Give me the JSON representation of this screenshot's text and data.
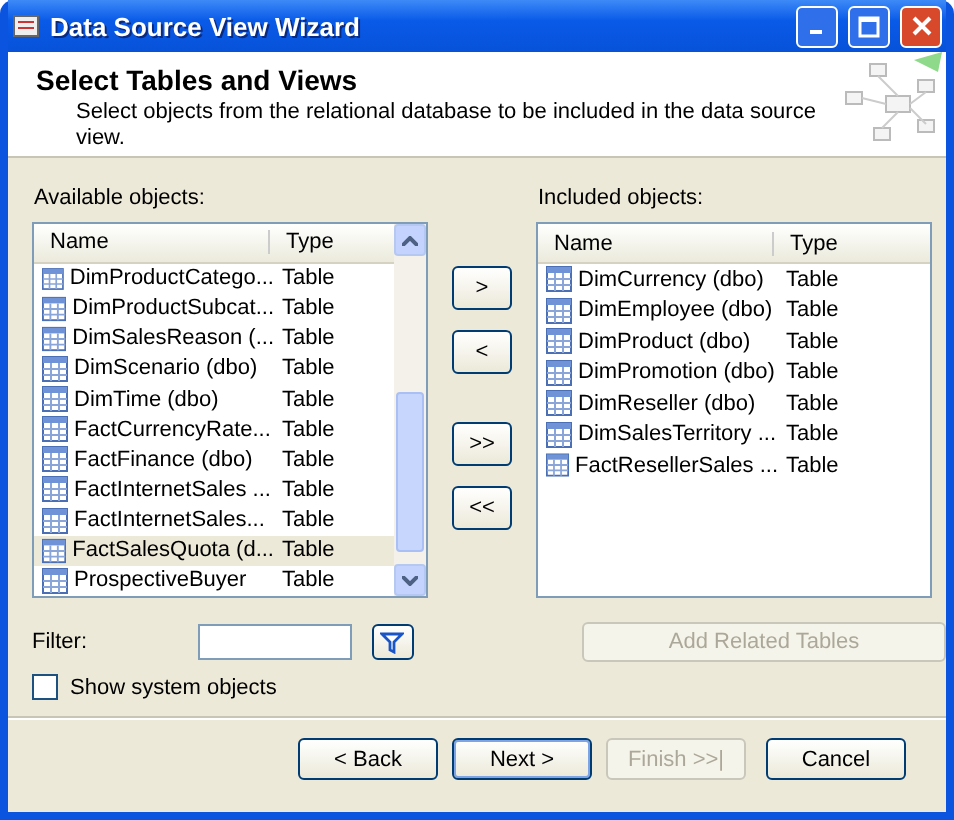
{
  "window": {
    "title": "Data Source View Wizard"
  },
  "header": {
    "title": "Select Tables and Views",
    "description": "Select objects from the relational database to be included in the data source view."
  },
  "available": {
    "label": "Available objects:",
    "columns": [
      "Name",
      "Type"
    ],
    "rows": [
      {
        "name": "DimProductCatego...",
        "type": "Table",
        "selected": false
      },
      {
        "name": "DimProductSubcat...",
        "type": "Table",
        "selected": false
      },
      {
        "name": "DimSalesReason (...",
        "type": "Table",
        "selected": false
      },
      {
        "name": "DimScenario (dbo)",
        "type": "Table",
        "selected": false
      },
      {
        "name": "DimTime (dbo)",
        "type": "Table",
        "selected": false
      },
      {
        "name": "FactCurrencyRate...",
        "type": "Table",
        "selected": false
      },
      {
        "name": "FactFinance (dbo)",
        "type": "Table",
        "selected": false
      },
      {
        "name": "FactInternetSales ...",
        "type": "Table",
        "selected": false
      },
      {
        "name": "FactInternetSales...",
        "type": "Table",
        "selected": false
      },
      {
        "name": "FactSalesQuota (d...",
        "type": "Table",
        "selected": true
      },
      {
        "name": "ProspectiveBuyer",
        "type": "Table",
        "selected": false
      }
    ]
  },
  "move_buttons": [
    ">",
    "<",
    ">>",
    "<<"
  ],
  "included": {
    "label": "Included objects:",
    "columns": [
      "Name",
      "Type"
    ],
    "rows": [
      {
        "name": "DimCurrency (dbo)",
        "type": "Table",
        "selected": false
      },
      {
        "name": "DimEmployee (dbo)",
        "type": "Table",
        "selected": false
      },
      {
        "name": "DimProduct (dbo)",
        "type": "Table",
        "selected": false
      },
      {
        "name": "DimPromotion (dbo)",
        "type": "Table",
        "selected": false
      },
      {
        "name": "DimReseller (dbo)",
        "type": "Table",
        "selected": false
      },
      {
        "name": "DimSalesTerritory ...",
        "type": "Table",
        "selected": false
      },
      {
        "name": "FactResellerSales ...",
        "type": "Table",
        "selected": false
      }
    ]
  },
  "filter": {
    "label": "Filter:"
  },
  "add_related": {
    "label": "Add Related Tables",
    "disabled": true
  },
  "show_system": {
    "label": "Show system objects",
    "checked": false
  },
  "buttons": [
    {
      "label": "< Back",
      "disabled": false,
      "default": false
    },
    {
      "label": "Next >",
      "disabled": false,
      "default": true
    },
    {
      "label": "Finish >>|",
      "disabled": true,
      "default": false
    },
    {
      "label": "Cancel",
      "disabled": false,
      "default": false
    }
  ]
}
